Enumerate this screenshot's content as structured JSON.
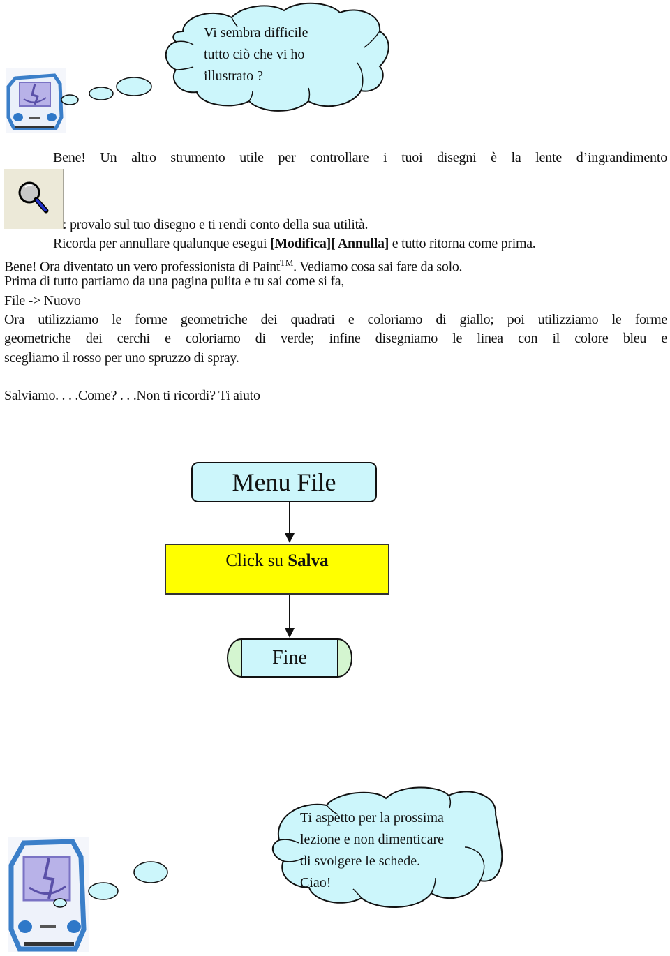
{
  "top_bubble": {
    "lines": [
      "Vi sembra difficile",
      "tutto ciò che vi ho",
      "illustrato ?"
    ]
  },
  "intro": {
    "line1": "Bene! Un altro strumento utile per controllare i tuoi disegni è la lente d’ingrandimento",
    "line2": ": provalo sul tuo disegno e ti rendi conto della sua utilità."
  },
  "undo_tip": {
    "prefix": "Ricorda per annullare qualunque esegui ",
    "menu": "[Modifica][ Annulla]",
    "suffix": " e tutto ritorna come prima."
  },
  "pro_line": {
    "prefix": "Bene! Ora diventato un vero professionista di Paint",
    "trademark": "TM",
    "suffix": ". Vediamo cosa sai fare da solo."
  },
  "steps": {
    "clean_page": "Prima di tutto partiamo da una pagina pulita e tu sai come si fa,",
    "file_new": "File -> Nuovo",
    "exercise_1": "Ora utilizziamo le forme geometriche dei quadrati e coloriamo di giallo; poi utilizziamo le forme",
    "exercise_2": "geometriche dei cerchi e coloriamo di verde; infine disegniamo le linea con il colore bleu e",
    "exercise_3": "scegliamo il rosso per uno spruzzo di spray.",
    "save": "Salviamo. . . .Come? . . .Non ti ricordi? Ti aiuto"
  },
  "flowchart": {
    "start": "Menu File",
    "action_prefix": "Click su ",
    "action_bold": "Salva",
    "end": "Fine",
    "colors": {
      "start": "#ccf6fb",
      "action": "#ffff00",
      "end": "#ccf6fb",
      "end_caps": "#d4f5d0"
    }
  },
  "bottom_bubble": {
    "lines": [
      "Ti aspetto per la prossima",
      "lezione e non dimenticare",
      "di svolgere le schede.",
      "Ciao!"
    ]
  },
  "icons": {
    "mac_character": "classic-mac-finder-icon",
    "zoom_tool": "magnifier-icon"
  },
  "colors": {
    "cloud_fill": "#ccf6fb",
    "outline": "#111111"
  }
}
